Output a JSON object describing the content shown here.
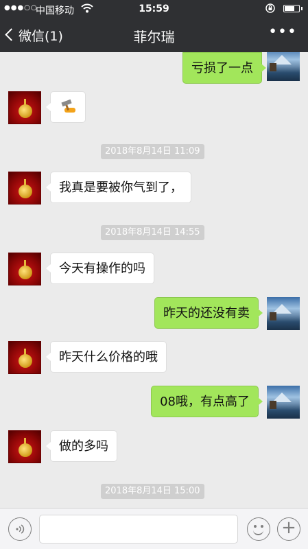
{
  "status_bar": {
    "signal": "●●●○○",
    "carrier": "中国移动",
    "wifi_icon": "wifi-icon",
    "time": "15:59",
    "lock_icon": "rotation-lock-icon",
    "battery_level": 0.75
  },
  "nav": {
    "back_label": "微信(1)",
    "title": "菲尔瑞",
    "more_label": "•••"
  },
  "messages": [
    {
      "type": "text",
      "side": "right",
      "text": "亏损了一点"
    },
    {
      "type": "sticker",
      "side": "left",
      "icon": "hammer-sticker-icon"
    },
    {
      "type": "time",
      "text": "2018年8月14日 11:09"
    },
    {
      "type": "text",
      "side": "left",
      "text": "我真是要被你气到了，"
    },
    {
      "type": "time",
      "text": "2018年8月14日 14:55"
    },
    {
      "type": "text",
      "side": "left",
      "text": "今天有操作的吗"
    },
    {
      "type": "text",
      "side": "right",
      "text": "昨天的还没有卖"
    },
    {
      "type": "text",
      "side": "left",
      "text": "昨天什么价格的哦"
    },
    {
      "type": "text",
      "side": "right",
      "text": "08哦，有点高了"
    },
    {
      "type": "text",
      "side": "left",
      "text": "做的多吗"
    },
    {
      "type": "time",
      "text": "2018年8月14日 15:00"
    }
  ],
  "input_bar": {
    "voice_icon": "voice-icon",
    "input_value": "",
    "emoji_icon": "emoji-icon",
    "plus_icon": "plus-icon",
    "plus_label": "+"
  },
  "colors": {
    "header_bg": "#2f3033",
    "chat_bg": "#ebebeb",
    "bubble_self": "#a2e65b",
    "bubble_other": "#ffffff"
  }
}
